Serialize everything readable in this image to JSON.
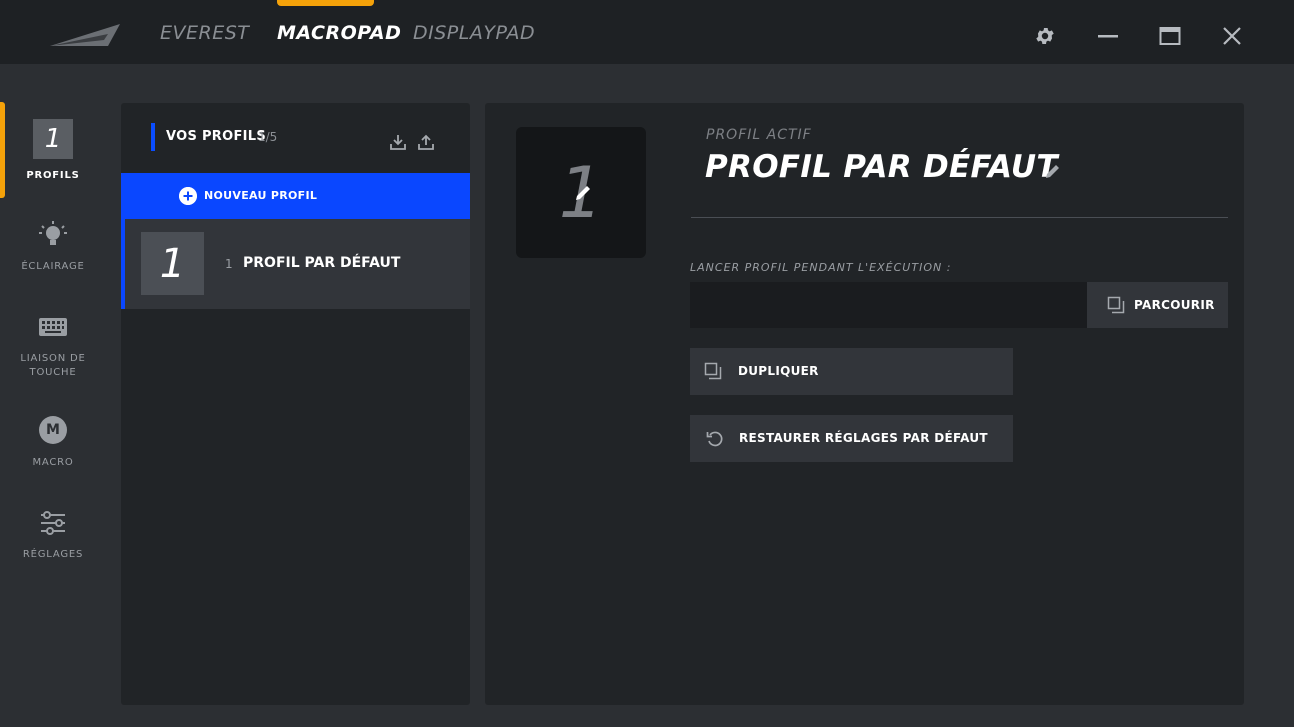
{
  "topbar": {
    "tabs": [
      {
        "label": "EVEREST",
        "active": false
      },
      {
        "label": "MACROPAD",
        "active": true
      },
      {
        "label": "DISPLAYPAD",
        "active": false
      }
    ],
    "accent_color": "#f5a20a",
    "window_controls": [
      "gear-icon",
      "minimize-icon",
      "maximize-icon",
      "close-icon"
    ]
  },
  "sidebar": {
    "items": [
      {
        "label": "PROFILS",
        "icon": "profile-number-icon",
        "badge": "1",
        "active": true
      },
      {
        "label": "ÉCLAIRAGE",
        "icon": "lightbulb-icon",
        "active": false
      },
      {
        "label": "LIAISON DE TOUCHE",
        "icon": "keyboard-icon",
        "active": false
      },
      {
        "label": "MACRO",
        "icon": "macro-m-icon",
        "badge": "M",
        "active": false
      },
      {
        "label": "RÉGLAGES",
        "icon": "sliders-icon",
        "active": false
      }
    ]
  },
  "profiles": {
    "title": "VOS PROFILS",
    "count": "1/5",
    "new_profile_label": "NOUVEAU PROFIL",
    "accent_color": "#0a47ff",
    "items": [
      {
        "thumb": "1",
        "number": "1",
        "name": "PROFIL PAR DÉFAUT",
        "selected": true
      }
    ]
  },
  "detail": {
    "thumb": "1",
    "active_label": "PROFIL ACTIF",
    "active_name": "PROFIL PAR DÉFAUT",
    "launch_label": "LANCER PROFIL PENDANT L'EXÉCUTION :",
    "launch_value": "",
    "browse_label": "PARCOURIR",
    "duplicate_label": "DUPLIQUER",
    "restore_label": "RESTAURER RÉGLAGES PAR DÉFAUT"
  }
}
